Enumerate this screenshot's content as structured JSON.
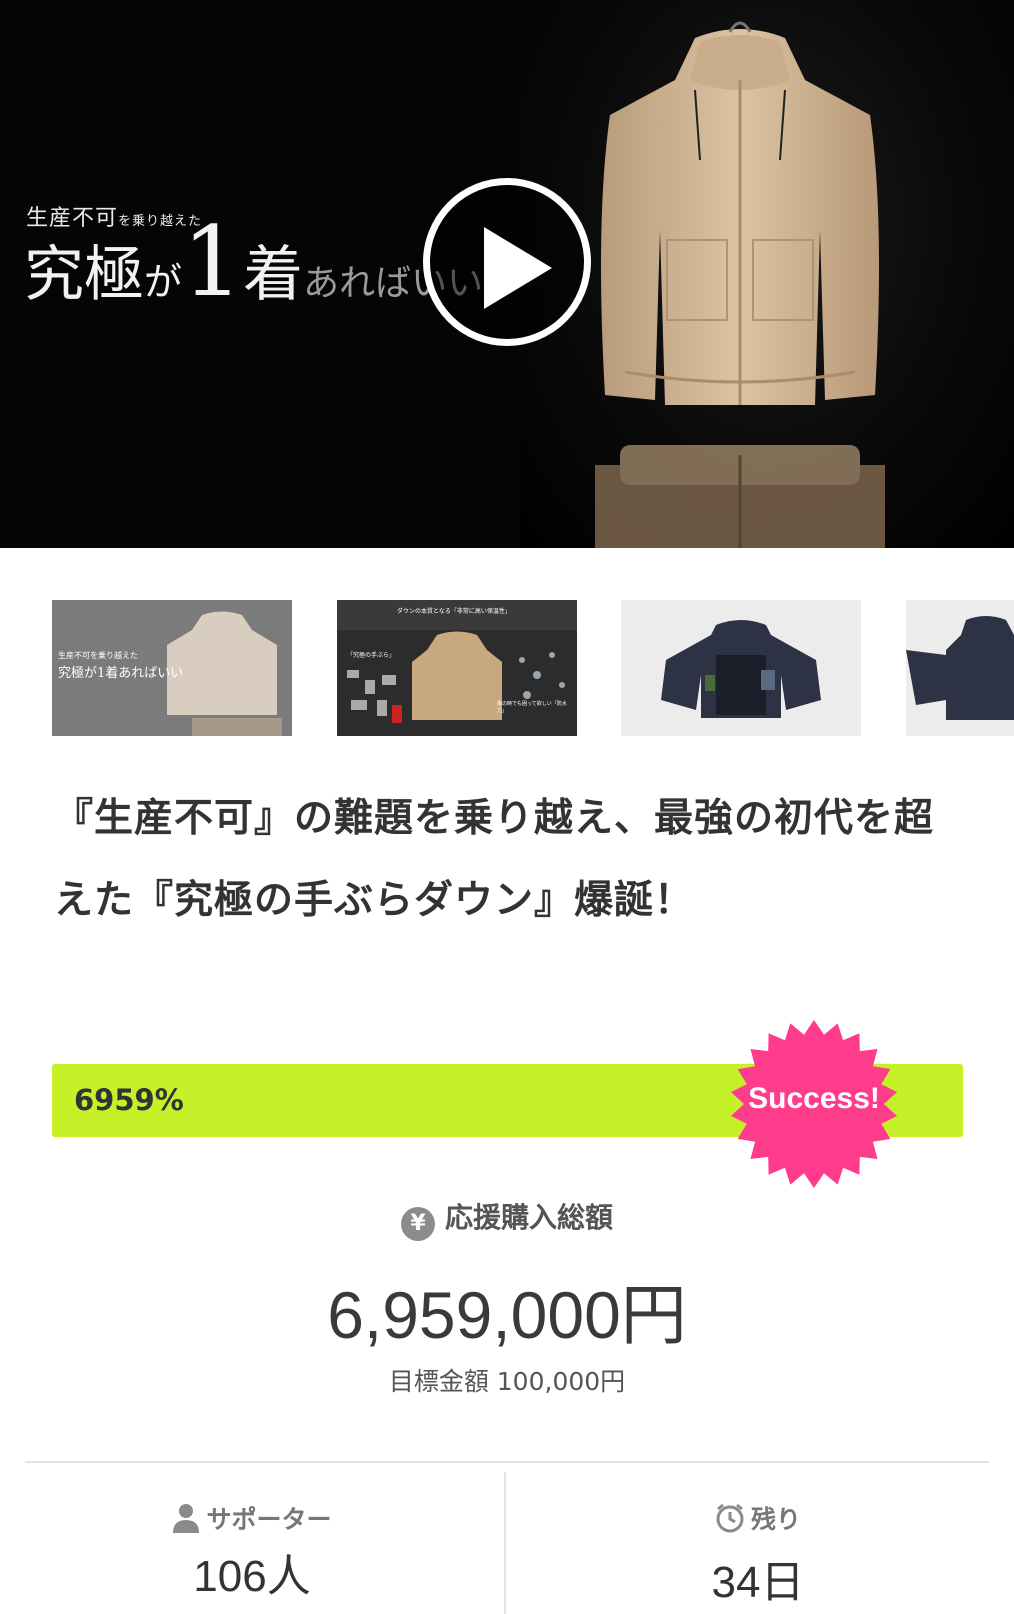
{
  "hero": {
    "subtitle_main": "生産不可",
    "subtitle_small": "を乗り越えた",
    "headline_a": "究極",
    "headline_b": "が",
    "headline_c": "1",
    "headline_d": "着",
    "headline_e": "あればいい"
  },
  "thumbnails": [
    {
      "caption_small": "生産不可を乗り越えた",
      "caption_main": "究極が1着あればいい"
    },
    {
      "caption_lines": [
        "ダウンの本質となる「非常に高い保温性」",
        "「究極の手ぶら」",
        "風の時でも困って欲しい「防水力」"
      ]
    },
    {
      "caption": ""
    },
    {
      "caption": ""
    }
  ],
  "title": "『生産不可』の難題を乗り越え、最強の初代を超えた『究極の手ぶらダウン』爆誕！",
  "progress": {
    "percent_label": "6959%",
    "fill_fraction": 1.0,
    "badge": "Success!",
    "accent": "#c6f128",
    "badge_color": "#ff3c8c"
  },
  "funding": {
    "label": "応援購入総額",
    "yen_icon": "¥",
    "amount": "6,959,000円",
    "target": "目標金額 100,000円"
  },
  "stats": {
    "supporters_label": "サポーター",
    "supporters_value": "106人",
    "remaining_label": "残り",
    "remaining_value": "34日"
  }
}
